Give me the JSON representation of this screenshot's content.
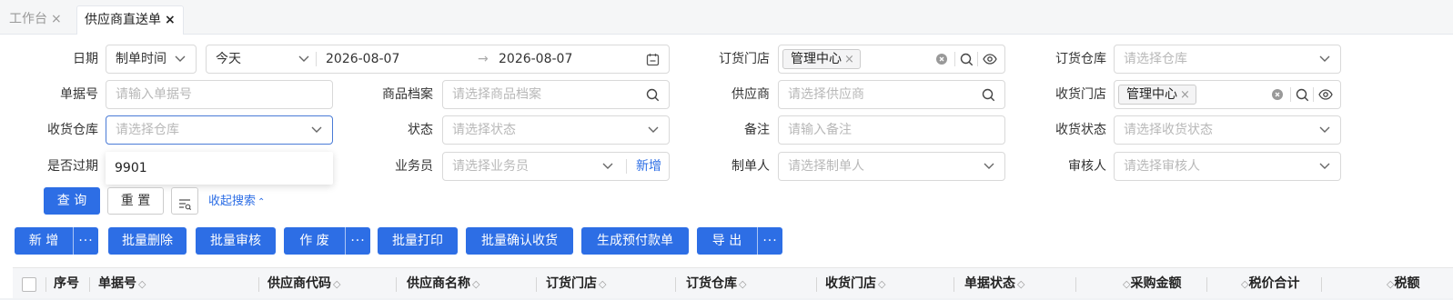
{
  "tabs": [
    {
      "label": "工作台",
      "close": "×"
    },
    {
      "label": "供应商直送单",
      "close": "×"
    }
  ],
  "filters": {
    "date": {
      "label": "日期",
      "type_value": "制单时间",
      "range_value": "今天",
      "start": "2026-08-07",
      "arrow": "→",
      "end": "2026-08-07"
    },
    "order_store": {
      "label": "订货门店",
      "tag": "管理中心"
    },
    "order_warehouse": {
      "label": "订货仓库",
      "placeholder": "请选择仓库"
    },
    "doc_no": {
      "label": "单据号",
      "placeholder": "请输入单据号"
    },
    "product": {
      "label": "商品档案",
      "placeholder": "请选择商品档案"
    },
    "supplier": {
      "label": "供应商",
      "placeholder": "请选择供应商"
    },
    "receive_store": {
      "label": "收货门店",
      "tag": "管理中心"
    },
    "receive_warehouse": {
      "label": "收货仓库",
      "placeholder": "请选择仓库",
      "option": "9901"
    },
    "status": {
      "label": "状态",
      "placeholder": "请选择状态"
    },
    "remark": {
      "label": "备注",
      "placeholder": "请输入备注"
    },
    "receive_status": {
      "label": "收货状态",
      "placeholder": "请选择收货状态"
    },
    "expired": {
      "label": "是否过期"
    },
    "salesman": {
      "label": "业务员",
      "placeholder": "请选择业务员",
      "add": "新增"
    },
    "creator": {
      "label": "制单人",
      "placeholder": "请选择制单人"
    },
    "auditor": {
      "label": "审核人",
      "placeholder": "请选择审核人"
    }
  },
  "search": {
    "query": "查 询",
    "reset": "重 置",
    "collapse": "收起搜索"
  },
  "toolbar": {
    "add": "新 增",
    "more": "···",
    "batch_delete": "批量删除",
    "batch_audit": "批量审核",
    "void": "作 废",
    "batch_print": "批量打印",
    "batch_confirm": "批量确认收货",
    "prepay": "生成预付款单",
    "export": "导 出"
  },
  "columns": [
    "序号",
    "单据号",
    "供应商代码",
    "供应商名称",
    "订货门店",
    "订货仓库",
    "收货门店",
    "单据状态",
    "采购金额",
    "税价合计",
    "税额"
  ],
  "colors": {
    "primary": "#2d6ee5",
    "focus": "#4a7bd6"
  }
}
